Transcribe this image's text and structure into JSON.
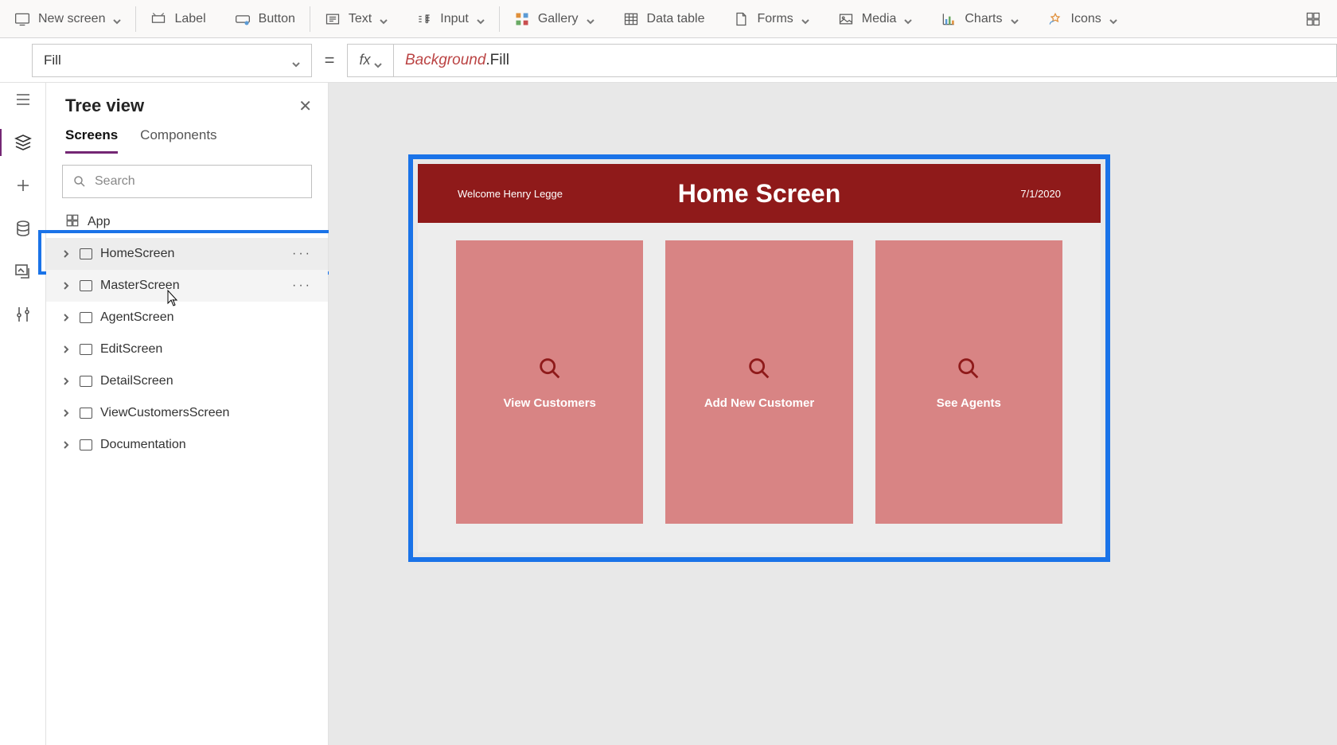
{
  "ribbon": {
    "new_screen": "New screen",
    "label": "Label",
    "button": "Button",
    "text": "Text",
    "input": "Input",
    "gallery": "Gallery",
    "data_table": "Data table",
    "forms": "Forms",
    "media": "Media",
    "charts": "Charts",
    "icons": "Icons"
  },
  "formula": {
    "property": "Fill",
    "expr_obj": "Background",
    "expr_prop": ".Fill"
  },
  "tree": {
    "title": "Tree view",
    "tabs": {
      "screens": "Screens",
      "components": "Components"
    },
    "search_placeholder": "Search",
    "app_label": "App",
    "items": [
      {
        "label": "HomeScreen"
      },
      {
        "label": "MasterScreen"
      },
      {
        "label": "AgentScreen"
      },
      {
        "label": "EditScreen"
      },
      {
        "label": "DetailScreen"
      },
      {
        "label": "ViewCustomersScreen"
      },
      {
        "label": "Documentation"
      }
    ]
  },
  "canvas": {
    "welcome": "Welcome Henry Legge",
    "title": "Home Screen",
    "date": "7/1/2020",
    "tiles": [
      {
        "label": "View Customers"
      },
      {
        "label": "Add New Customer"
      },
      {
        "label": "See Agents"
      }
    ]
  }
}
